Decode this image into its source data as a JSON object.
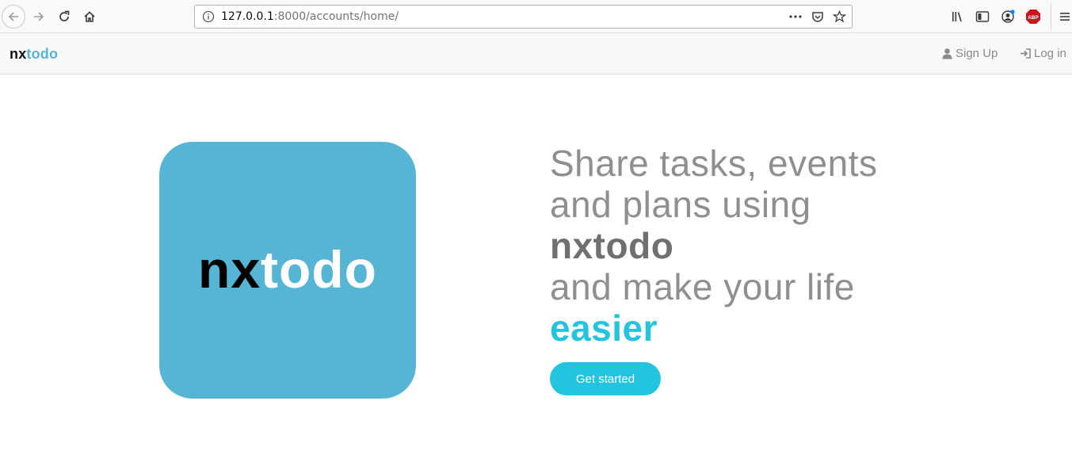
{
  "browser": {
    "url_host": "127.0.0.1",
    "url_rest": ":8000/accounts/home/",
    "toolbar_icons": [
      "back-icon",
      "forward-icon",
      "reload-icon",
      "home-icon",
      "info-icon",
      "page-actions-icon",
      "pocket-icon",
      "bookmark-star-icon",
      "library-icon",
      "sidebar-icon",
      "account-icon",
      "adblock-icon",
      "menu-icon"
    ],
    "adblock_label": "ABP"
  },
  "navbar": {
    "brand_nx": "nx",
    "brand_todo": "todo",
    "signup_label": "Sign Up",
    "login_label": "Log in"
  },
  "hero": {
    "logo_nx": "nx",
    "logo_todo": "todo",
    "line1": "Share tasks, events",
    "line2": "and plans using",
    "line3": "nxtodo",
    "line4": "and make your life",
    "line5": "easier",
    "cta_label": "Get started"
  },
  "colors": {
    "brand_blue": "#56b5d4",
    "accent_cyan": "#23c4df",
    "text_gray": "#8f8f8f"
  }
}
